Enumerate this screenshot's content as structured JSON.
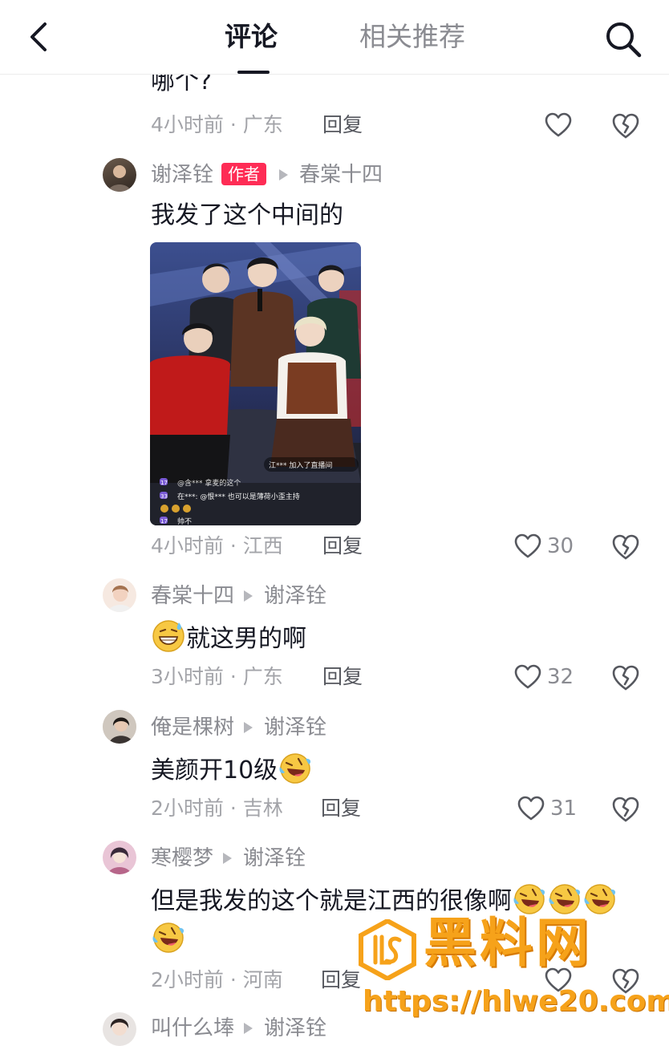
{
  "header": {
    "tabs": [
      {
        "label": "评论",
        "active": true
      },
      {
        "label": "相关推荐",
        "active": false
      }
    ],
    "icons": {
      "back": "chevron-left-icon",
      "search": "search-icon"
    }
  },
  "comments": [
    {
      "text": "哪个?",
      "time_location": "4小时前 · 广东",
      "reply_label": "回复",
      "likes": ""
    },
    {
      "user": "谢泽铨",
      "author_tag": "作者",
      "reply_to": "春棠十四",
      "text": "我发了这个中间的",
      "time_location": "4小时前 · 江西",
      "reply_label": "回复",
      "likes": "30"
    },
    {
      "user": "春棠十四",
      "reply_to": "谢泽铨",
      "text": "就这男的啊",
      "time_location": "3小时前 · 广东",
      "reply_label": "回复",
      "likes": "32"
    },
    {
      "user": "俺是棵树",
      "reply_to": "谢泽铨",
      "text": "美颜开10级",
      "time_location": "2小时前 · 吉林",
      "reply_label": "回复",
      "likes": "31"
    },
    {
      "user": "寒樱梦",
      "reply_to": "谢泽铨",
      "text": "但是我发的这个就是江西的很像啊",
      "time_location": "2小时前 · 河南",
      "reply_label": "回复",
      "likes": ""
    },
    {
      "user": "叫什么埲",
      "reply_to": "谢泽铨"
    }
  ],
  "photo_overlay": {
    "join_notice": "江*** 加入了直播间",
    "chat": [
      {
        "badge": "17",
        "text": "@含*** 拿麦的这个"
      },
      {
        "badge": "33",
        "text": "在***: @恨*** 也可以是薄荷小歪主持"
      },
      {
        "badge": "17",
        "text": "帅不"
      }
    ]
  },
  "watermark": {
    "brand": "黑料网",
    "url": "https://hlwe20.com"
  },
  "colors": {
    "author_tag": "#fe2c55",
    "watermark": "#f6a21a",
    "primary_text": "#161823",
    "secondary_text": "#8a8b91"
  }
}
